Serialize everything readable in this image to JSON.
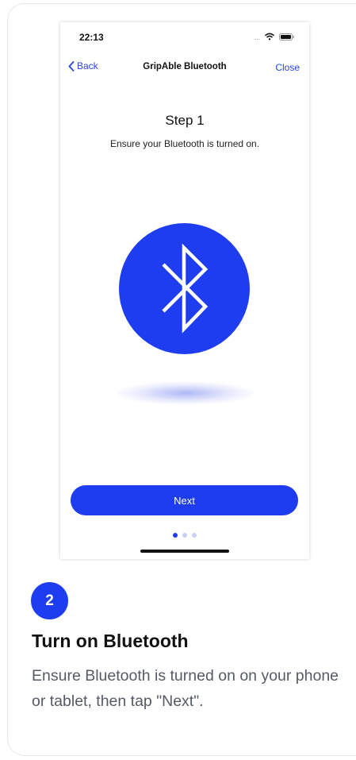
{
  "phone": {
    "status_bar": {
      "time": "22:13",
      "signal": "....",
      "icons": [
        "wifi-icon",
        "battery-icon"
      ]
    },
    "nav": {
      "back_label": "Back",
      "back_icon": "chevron-left-icon",
      "title": "GripAble Bluetooth",
      "close_label": "Close"
    },
    "step": {
      "title": "Step 1",
      "description": "Ensure your Bluetooth is turned on."
    },
    "illustration_icon": "bluetooth-icon",
    "next_label": "Next",
    "pagination": {
      "total": 3,
      "current": 1
    }
  },
  "instruction": {
    "step_number": "2",
    "title": "Turn on Bluetooth",
    "description": "Ensure Bluetooth is turned on on your phone or tablet, then tap \"Next\"."
  },
  "colors": {
    "accent": "#1f3df0",
    "link": "#2745e0",
    "dot_inactive": "#c9cff7",
    "body_text": "#555a66"
  }
}
